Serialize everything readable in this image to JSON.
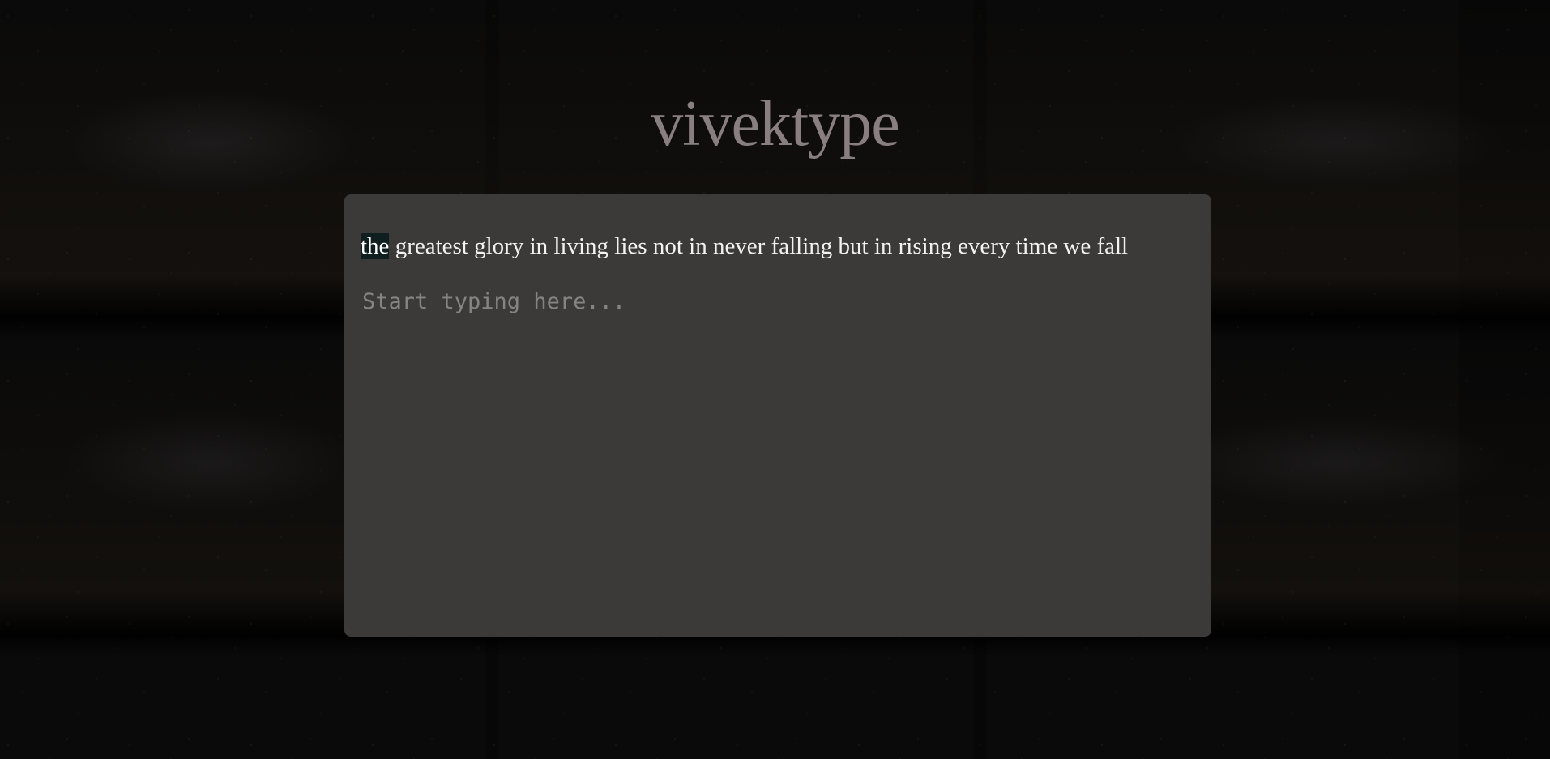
{
  "app": {
    "title": "vivektype"
  },
  "quote": {
    "current_word": "the",
    "rest": " greatest glory in living lies not in never falling but in rising every time we fall"
  },
  "input": {
    "value": "",
    "placeholder": "Start typing here..."
  },
  "colors": {
    "title": "#8a7f80",
    "card_background": "#3c3939",
    "quote_text": "#f4f1f1",
    "current_word_highlight": "#0f1e1f",
    "placeholder": "#878383",
    "page_background": "#060606"
  }
}
